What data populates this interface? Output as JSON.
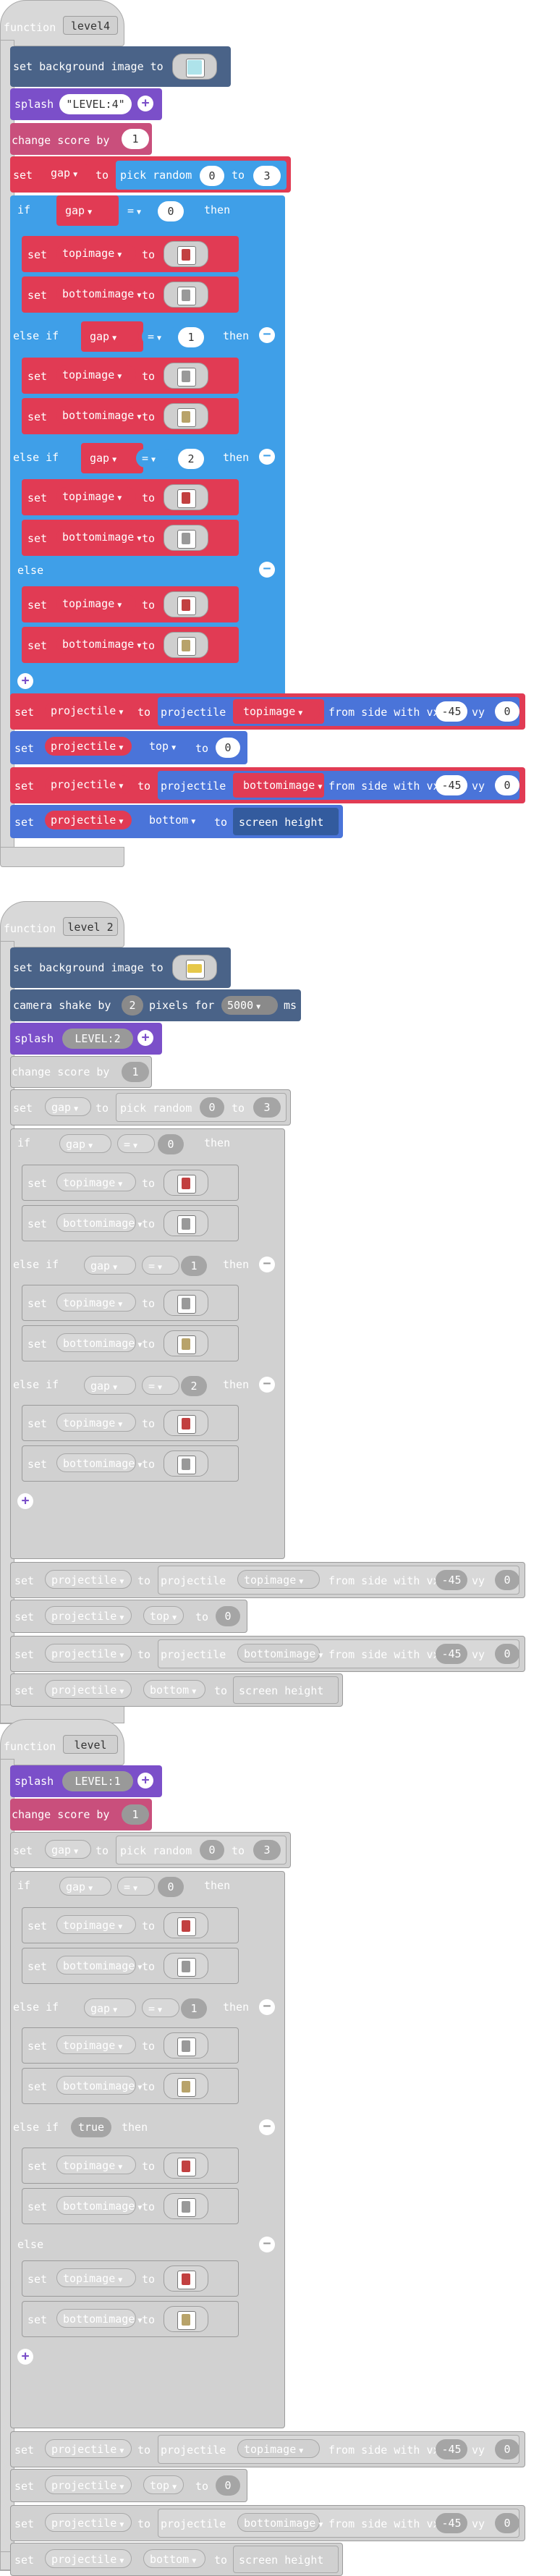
{
  "colors": {
    "function": "#d9d9d9",
    "background": "#4a6388",
    "splash": "#7b4fc9",
    "score": "#c94f7c",
    "variable": "#e13b54",
    "logic": "#3f9fe8",
    "sprite": "#4a74d9",
    "gray": "#d1d1d1",
    "gray_border": "#9b9b9b",
    "gray_text": "#ffffff"
  },
  "functions": [
    {
      "keyword": "function",
      "name": "level4",
      "splash_text": "\"LEVEL:4\"",
      "score_value": "1",
      "random_from": "0",
      "random_to": "3",
      "compare1": "0",
      "compare2": "1",
      "compare3": "2",
      "vx": "-45",
      "vy": "0"
    },
    {
      "keyword": "function",
      "name": "level 2",
      "shake_amount": "2",
      "shake_ms": "5000",
      "splash_text": "LEVEL:2",
      "score_value": "1",
      "random_from": "0",
      "random_to": "3",
      "compare1": "0",
      "compare2": "1",
      "compare3": "2",
      "vx": "-45",
      "vy": "0"
    },
    {
      "keyword": "function",
      "name": "level",
      "splash_text": "LEVEL:1",
      "score_value": "1",
      "random_from": "0",
      "random_to": "3",
      "compare1": "0",
      "compare2": "1",
      "compare3": "true",
      "vx": "-45",
      "vy": "0"
    }
  ],
  "labels": {
    "set_background": "set background image to",
    "splash": "splash",
    "change_score": "change score by",
    "set": "set",
    "to": "to",
    "pick_random": "pick random",
    "pick_to": "to",
    "if": "if",
    "then": "then",
    "else_if": "else if",
    "else": "else",
    "eq": "=",
    "gap": "gap",
    "topimage": "topimage",
    "bottomimage": "bottomimage",
    "projectile": "projectile",
    "projectile_fn": "projectile",
    "from_side": "from side with vx",
    "vy": "vy",
    "top": "top",
    "bottom": "bottom",
    "screen_height": "screen height",
    "camera_shake": "camera shake by",
    "pixels_for": "pixels for",
    "ms": "ms"
  }
}
